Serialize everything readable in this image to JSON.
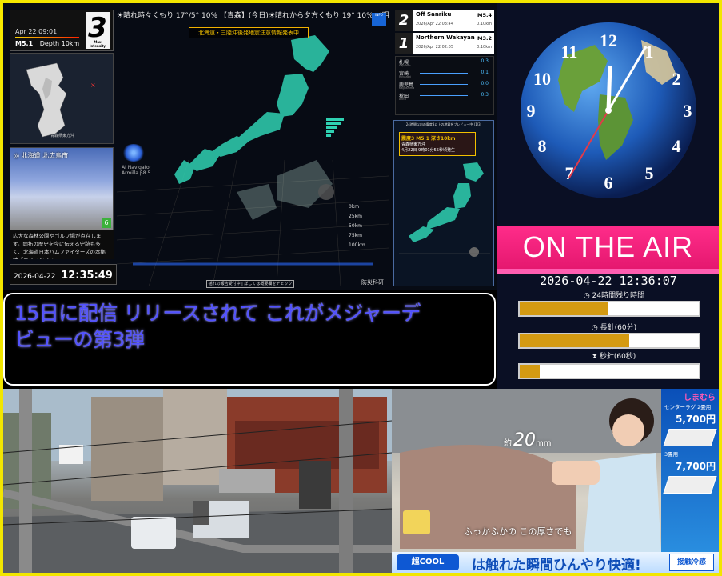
{
  "quake": {
    "ticker": "☀晴れ時々くもり 17°/5° 10% 【青森】(今日)☀晴れから夕方くもり 19° 10%→(明日)☀晴れ 18°/4° 0%",
    "latest_time": "Apr 22 09:01",
    "latest_mag": "M5.1",
    "latest_depth": "Depth 10km",
    "max_intensity": "3",
    "max_intensity_label": "Max Intensity",
    "mini_map_label": "青森県東方沖",
    "camera_place": "北海道 北広島市",
    "camera_intensity": "6",
    "camera_desc": "広大な森林公園やゴルフ場が点在します。開拓の歴史を今に伝える史跡も多く、北海道日本ハムファイターズの本拠地「エスコンフィ",
    "clock_date": "2026-04-22",
    "clock_time": "12:35:49",
    "alert": "北海道・三陸沖後発地震注意情報発表中",
    "ai_nav_name": "AI Navigator",
    "ai_nav_sub": "Armilla β8.5",
    "bottom_pill": "揺れの報告受付中 | 詳しくは概要欄をチェック",
    "nied": "防災科研",
    "small_logo": "INFO",
    "list": [
      {
        "num": "2",
        "name": "Off Sanriku",
        "mag": "M5.4",
        "date": "2026/Apr 22 03:44",
        "depth": "0.10km"
      },
      {
        "num": "1",
        "name": "Northern Wakayan",
        "mag": "M3.2",
        "date": "2026/Apr 22 02:05",
        "depth": "0.10km"
      }
    ],
    "stations": [
      {
        "name": "札幌",
        "sub": "Sapporo",
        "val": "0.3"
      },
      {
        "name": "宮崎",
        "sub": "Miyazaki",
        "val": "0.1"
      },
      {
        "name": "鹿児島",
        "sub": "Kagoshima",
        "val": "0.0"
      },
      {
        "name": "秋田",
        "sub": "Akita",
        "val": "0.3"
      }
    ],
    "preview_head": "24時間以内の震度3以上の地震をプレビュー中 (1/3)",
    "preview_q": "震度3 M5.1 深さ10km",
    "preview_area": "青森県東方沖",
    "preview_date": "4月22日 9時01分55秒頃発生"
  },
  "clock": {
    "on_air": "ON THE AIR",
    "now": "2026-04-22 12:36:07",
    "gauge1_label": "24時間残り時間",
    "gauge1_value": 0.49,
    "gauge2_label": "長針(60分)",
    "gauge2_value": 0.61,
    "gauge3_label": "秒針(60秒)",
    "gauge3_value": 0.11
  },
  "caption": {
    "line1": "15日に配信 リリースされて これがメジャーデ",
    "line2": "ビューの第3弾"
  },
  "ad": {
    "thickness": "20",
    "thickness_prefix": "約",
    "thickness_unit": "mm",
    "tagline": "ふっかふかの この厚さでも",
    "brand": "しまむら",
    "product1": "センターラグ 2畳用",
    "price1": "5,700円",
    "product2": "3畳用",
    "price2": "7,700円",
    "logo": "超COOL",
    "headline": "は触れた瞬間ひんやり快適!",
    "badge": "接触冷感"
  },
  "colors": {
    "frame": "#f2e600",
    "on_air_bg": "#e5186f",
    "caption_text": "#5050ff",
    "gauge_fill": "#d49a12",
    "japan_map": "#2fd1b2"
  }
}
